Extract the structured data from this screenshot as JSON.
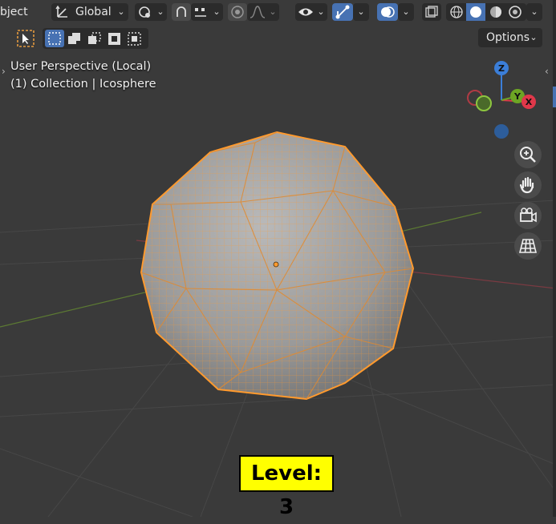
{
  "header": {
    "mode_label": "bject",
    "transform_orientation": "Global",
    "options_label": "Options"
  },
  "viewport": {
    "view_name": "User Perspective (Local)",
    "collection_label": "(1) Collection | Icosphere"
  },
  "gizmo": {
    "axis_z": "Z",
    "axis_y": "Y",
    "axis_x": "X"
  },
  "overlay": {
    "level_label": "Level: 3"
  },
  "colors": {
    "viewport_bg": "#3a3a3a",
    "selection_orange": "#ff9a2e",
    "axis_x_red": "#e0384a",
    "axis_y_green": "#6da524",
    "axis_z_blue": "#3b7ed8",
    "active_tool_blue": "#4772b3",
    "level_badge_bg": "#ffff00"
  },
  "icons": [
    "transform-orientation-icon",
    "snap-icon",
    "proportional-edit-icon",
    "falloff-icon",
    "visibility-icon",
    "gizmo-icon",
    "overlay-icon",
    "xray-icon",
    "wireframe-shading-icon",
    "solid-shading-icon",
    "material-shading-icon",
    "rendered-shading-icon",
    "select-box-icon",
    "zoom-icon",
    "pan-icon",
    "camera-icon",
    "grid-view-icon"
  ]
}
